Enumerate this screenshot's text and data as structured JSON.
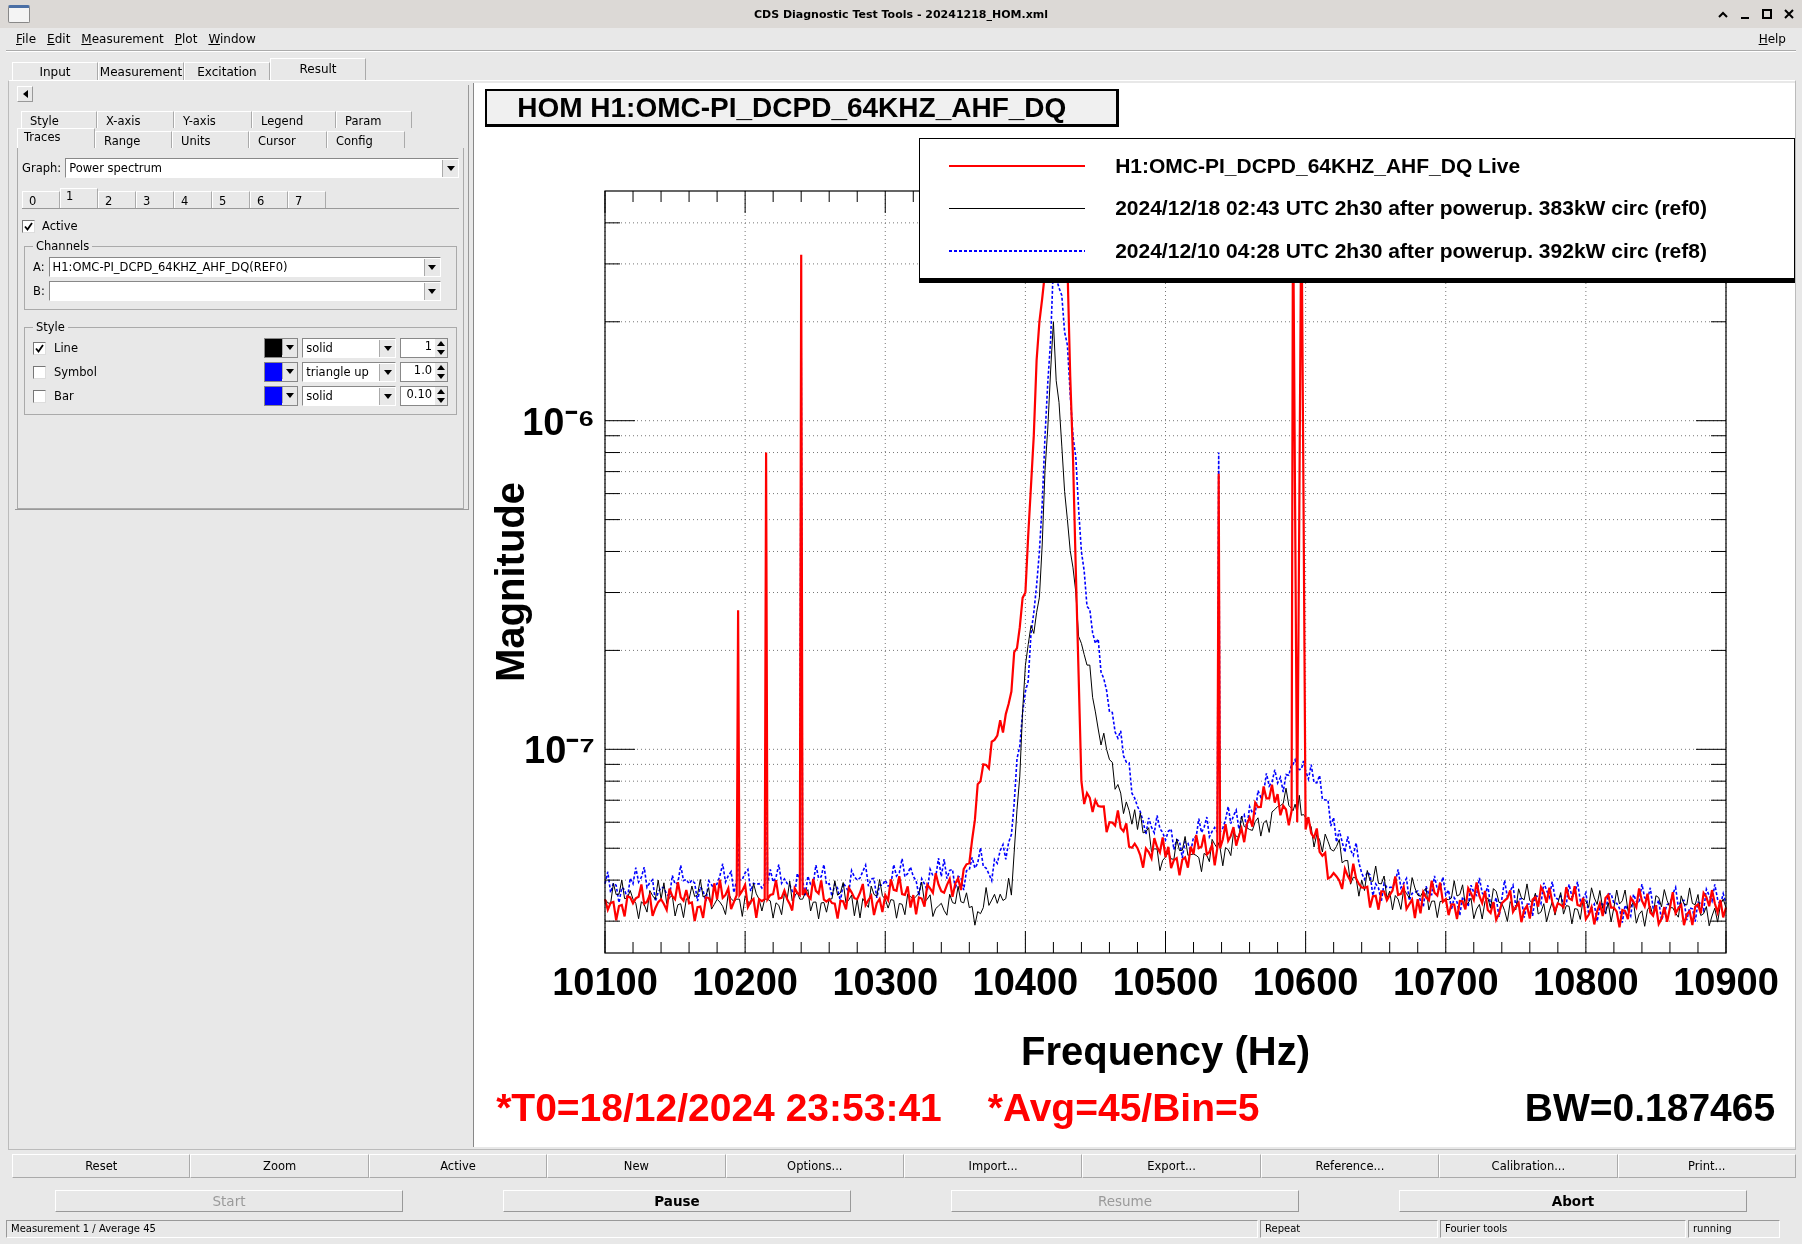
{
  "window": {
    "title": "CDS Diagnostic Test Tools - 20241218_HOM.xml"
  },
  "menu": {
    "items": [
      "File",
      "Edit",
      "Measurement",
      "Plot",
      "Window"
    ],
    "help": "Help"
  },
  "main_tabs": [
    {
      "label": "Input",
      "selected": false
    },
    {
      "label": "Measurement",
      "selected": false
    },
    {
      "label": "Excitation",
      "selected": false
    },
    {
      "label": "Result",
      "selected": true
    }
  ],
  "options_tabs": {
    "back_row": [
      {
        "label": "Style",
        "selected": false
      },
      {
        "label": "X-axis",
        "selected": false
      },
      {
        "label": "Y-axis",
        "selected": false
      },
      {
        "label": "Legend",
        "selected": false
      },
      {
        "label": "Param",
        "selected": false
      }
    ],
    "front_row": [
      {
        "label": "Traces",
        "selected": true
      },
      {
        "label": "Range",
        "selected": false
      },
      {
        "label": "Units",
        "selected": false
      },
      {
        "label": "Cursor",
        "selected": false
      },
      {
        "label": "Config",
        "selected": false
      }
    ]
  },
  "graph": {
    "label": "Graph:",
    "value": "Power spectrum"
  },
  "trace_tabs": [
    {
      "label": "0",
      "selected": false
    },
    {
      "label": "1",
      "selected": true
    },
    {
      "label": "2",
      "selected": false
    },
    {
      "label": "3",
      "selected": false
    },
    {
      "label": "4",
      "selected": false
    },
    {
      "label": "5",
      "selected": false
    },
    {
      "label": "6",
      "selected": false
    },
    {
      "label": "7",
      "selected": false
    }
  ],
  "active": {
    "label": "Active",
    "checked": true
  },
  "channels": {
    "title": "Channels",
    "rows": [
      {
        "label": "A:",
        "value": "H1:OMC-PI_DCPD_64KHZ_AHF_DQ(REF0)"
      },
      {
        "label": "B:"
      }
    ]
  },
  "style": {
    "title": "Style",
    "rows": [
      {
        "label": "Line",
        "checked": true,
        "color": "#000000",
        "style": "solid",
        "size": "1"
      },
      {
        "label": "Symbol",
        "checked": false,
        "color": "#0000ff",
        "style": "triangle up",
        "size": "1.0"
      },
      {
        "label": "Bar",
        "checked": false,
        "color": "#0000ff",
        "style": "solid",
        "size": "0.10"
      }
    ]
  },
  "plot": {
    "title": "HOM H1:OMC-PI_DCPD_64KHZ_AHF_DQ",
    "legend": [
      {
        "label": "H1:OMC-PI_DCPD_64KHZ_AHF_DQ Live",
        "color": "#ff0000",
        "kind": "thick"
      },
      {
        "label": "2024/12/18 02:43 UTC 2h30 after powerup. 383kW circ (ref0)",
        "color": "#000000",
        "kind": "thin"
      },
      {
        "label": "2024/12/10 04:28 UTC 2h30 after powerup. 392kW circ (ref8)",
        "color": "#0000ff",
        "kind": "dotted"
      }
    ],
    "x_ticks": [
      "10100",
      "10200",
      "10300",
      "10400",
      "10500",
      "10600",
      "10700",
      "10800",
      "10900"
    ],
    "y_ticks": [
      "10⁻⁶",
      "10⁻⁷"
    ],
    "xlabel": "Frequency (Hz)",
    "ylabel": "Magnitude",
    "footer": [
      "*T0=18/12/2024 23:53:41",
      "*Avg=45/Bin=5"
    ],
    "bandwidth": "BW=0.187465"
  },
  "buttons": [
    "Reset",
    "Zoom",
    "Active",
    "New",
    "Options...",
    "Import...",
    "Export...",
    "Reference...",
    "Calibration...",
    "Print..."
  ],
  "controls": [
    {
      "label": "Start",
      "disabled": true
    },
    {
      "label": "Pause",
      "disabled": false
    },
    {
      "label": "Resume",
      "disabled": true
    },
    {
      "label": "Abort",
      "disabled": false
    }
  ],
  "status_bar": [
    "Measurement 1 / Average 45",
    "Repeat",
    "Fourier tools",
    "running"
  ]
}
